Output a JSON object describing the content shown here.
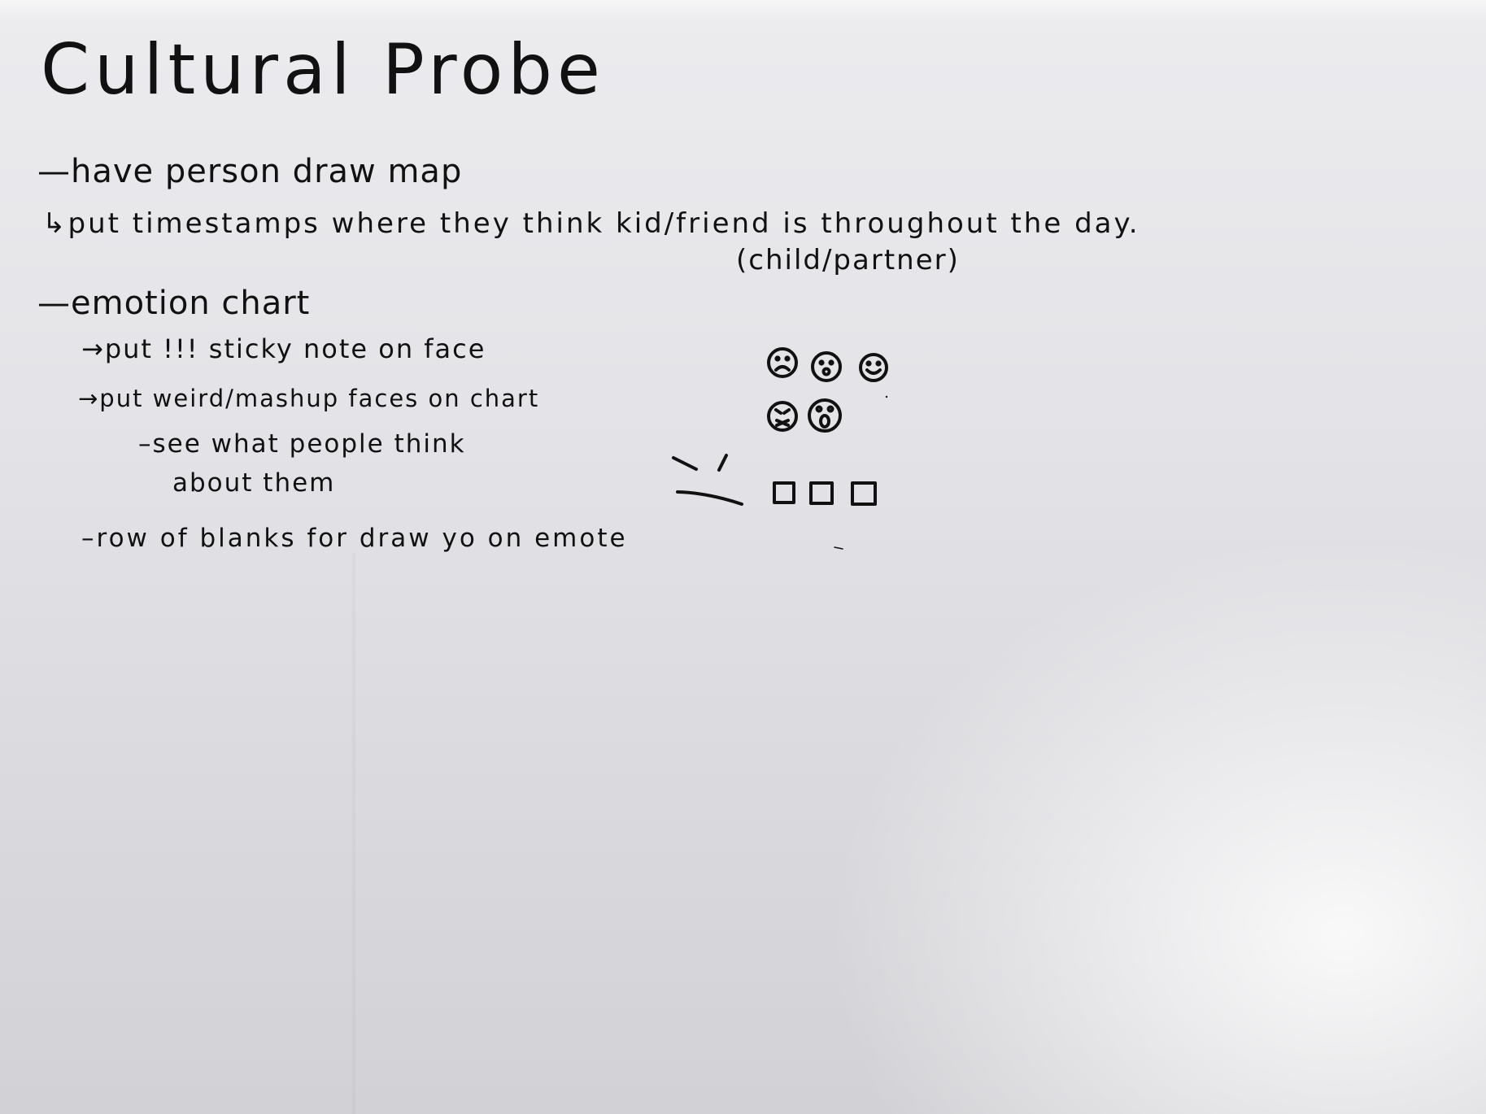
{
  "title": "Cultural Probe",
  "lines": {
    "map": "—have person draw map",
    "timestamps": "↳put timestamps where they think kid/friend is throughout the day.",
    "timestamps_note": "(child/partner)",
    "emotion_chart": "—emotion chart",
    "sticky_note": "→put !!! sticky note on face",
    "weird_faces": "→put weird/mashup faces on chart",
    "see_what": "–see what people think",
    "about_them": "about them",
    "blanks": "–row of blanks for draw yo on emote"
  },
  "icons": {
    "faces": [
      "sad-face-icon",
      "neutral-face-icon",
      "happy-face-icon",
      "angry-face-icon",
      "surprised-face-icon"
    ],
    "blanks": [
      "blank-square-icon",
      "blank-square-icon",
      "blank-square-icon"
    ],
    "doodle": "mashup-face-doodle"
  },
  "colors": {
    "ink": "#111111",
    "paper": "#e6e6ea"
  }
}
